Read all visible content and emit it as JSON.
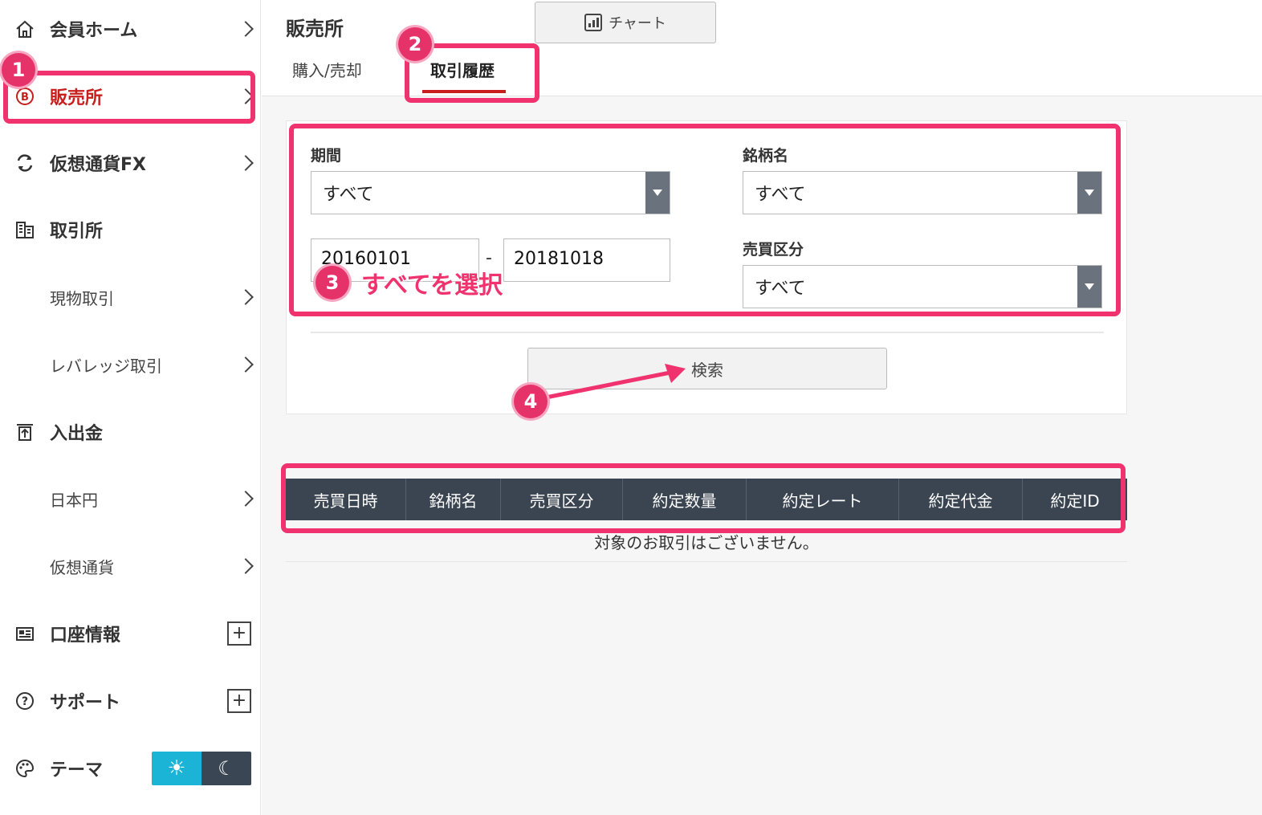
{
  "sidebar": {
    "items": [
      {
        "label": "会員ホーム",
        "icon": "home-icon"
      },
      {
        "label": "販売所",
        "icon": "bitcoin-icon"
      },
      {
        "label": "仮想通貨FX",
        "icon": "exchange-icon"
      },
      {
        "label": "取引所",
        "icon": "building-icon"
      },
      {
        "label": "現物取引"
      },
      {
        "label": "レバレッジ取引"
      },
      {
        "label": "入出金",
        "icon": "deposit-icon"
      },
      {
        "label": "日本円"
      },
      {
        "label": "仮想通貨"
      },
      {
        "label": "口座情報",
        "icon": "account-icon"
      },
      {
        "label": "サポート",
        "icon": "help-icon"
      },
      {
        "label": "テーマ",
        "icon": "palette-icon"
      }
    ],
    "theme": {
      "light_icon": "sun-icon",
      "dark_icon": "moon-icon"
    }
  },
  "header": {
    "title": "販売所",
    "chart_button": "チャート",
    "tabs": [
      {
        "label": "購入/売却"
      },
      {
        "label": "取引履歴"
      }
    ]
  },
  "filter": {
    "period_label": "期間",
    "period_value": "すべて",
    "date_from": "20160101",
    "date_sep": "-",
    "date_to": "20181018",
    "symbol_label": "銘柄名",
    "symbol_value": "すべて",
    "side_label": "売買区分",
    "side_value": "すべて",
    "search_button": "検索"
  },
  "table": {
    "columns": [
      "売買日時",
      "銘柄名",
      "売買区分",
      "約定数量",
      "約定レート",
      "約定代金",
      "約定ID"
    ],
    "empty_message": "対象のお取引はございません。"
  },
  "annotations": {
    "badges": [
      "1",
      "2",
      "3",
      "4"
    ],
    "note": "すべてを選択",
    "color": "#f0336e"
  }
}
